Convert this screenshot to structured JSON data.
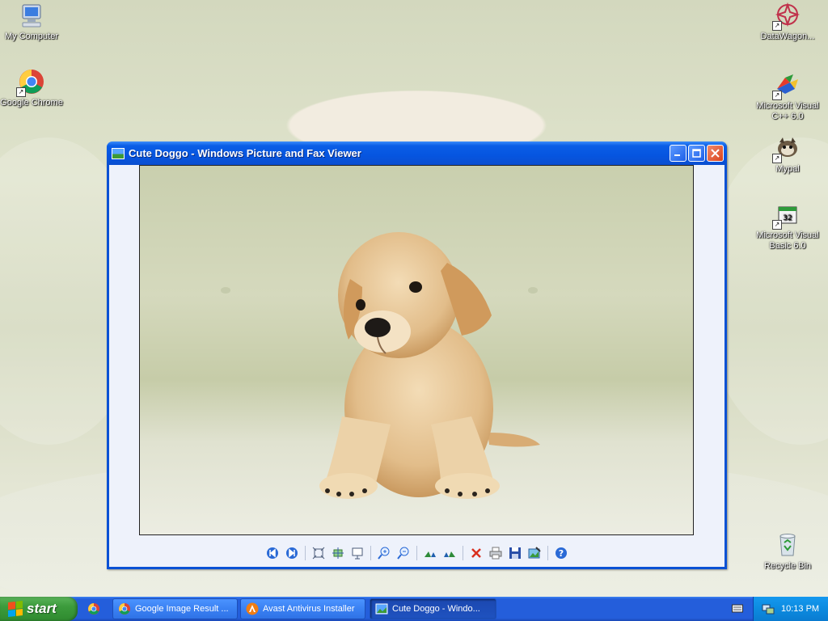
{
  "desktop": {
    "icons_left": [
      {
        "label": "My Computer",
        "icon": "computer-icon"
      },
      {
        "label": "Google Chrome",
        "icon": "chrome-icon"
      }
    ],
    "icons_right": [
      {
        "label": "DataWagon...",
        "icon": "datawagon-icon"
      },
      {
        "label": "Microsoft Visual C++ 6.0",
        "icon": "visual-cpp-icon"
      },
      {
        "label": "Mypal",
        "icon": "mypal-icon"
      },
      {
        "label": "Microsoft Visual Basic 6.0",
        "icon": "visual-basic-icon"
      },
      {
        "label": "Recycle Bin",
        "icon": "recycle-bin-icon"
      }
    ]
  },
  "window": {
    "title": "Cute Doggo - Windows Picture and Fax Viewer",
    "toolbar": [
      "previous-image-icon",
      "next-image-icon",
      "best-fit-icon",
      "actual-size-icon",
      "slideshow-icon",
      "zoom-in-icon",
      "zoom-out-icon",
      "rotate-clockwise-icon",
      "rotate-counterclockwise-icon",
      "delete-icon",
      "print-icon",
      "save-icon",
      "open-editor-icon",
      "help-icon"
    ]
  },
  "taskbar": {
    "start_label": "start",
    "tasks": [
      {
        "label": "Google Image Result ...",
        "icon": "chrome-icon"
      },
      {
        "label": "Avast Antivirus Installer",
        "icon": "avast-icon"
      },
      {
        "label": "Cute Doggo - Windo...",
        "icon": "picture-viewer-icon",
        "active": true
      }
    ],
    "clock": "10:13 PM"
  },
  "colors": {
    "title_bar": "#0a5ee6",
    "taskbar": "#245edb",
    "start_button": "#3c9b3c",
    "tray": "#0c8be0",
    "viewer_background": "#eef2fb"
  }
}
